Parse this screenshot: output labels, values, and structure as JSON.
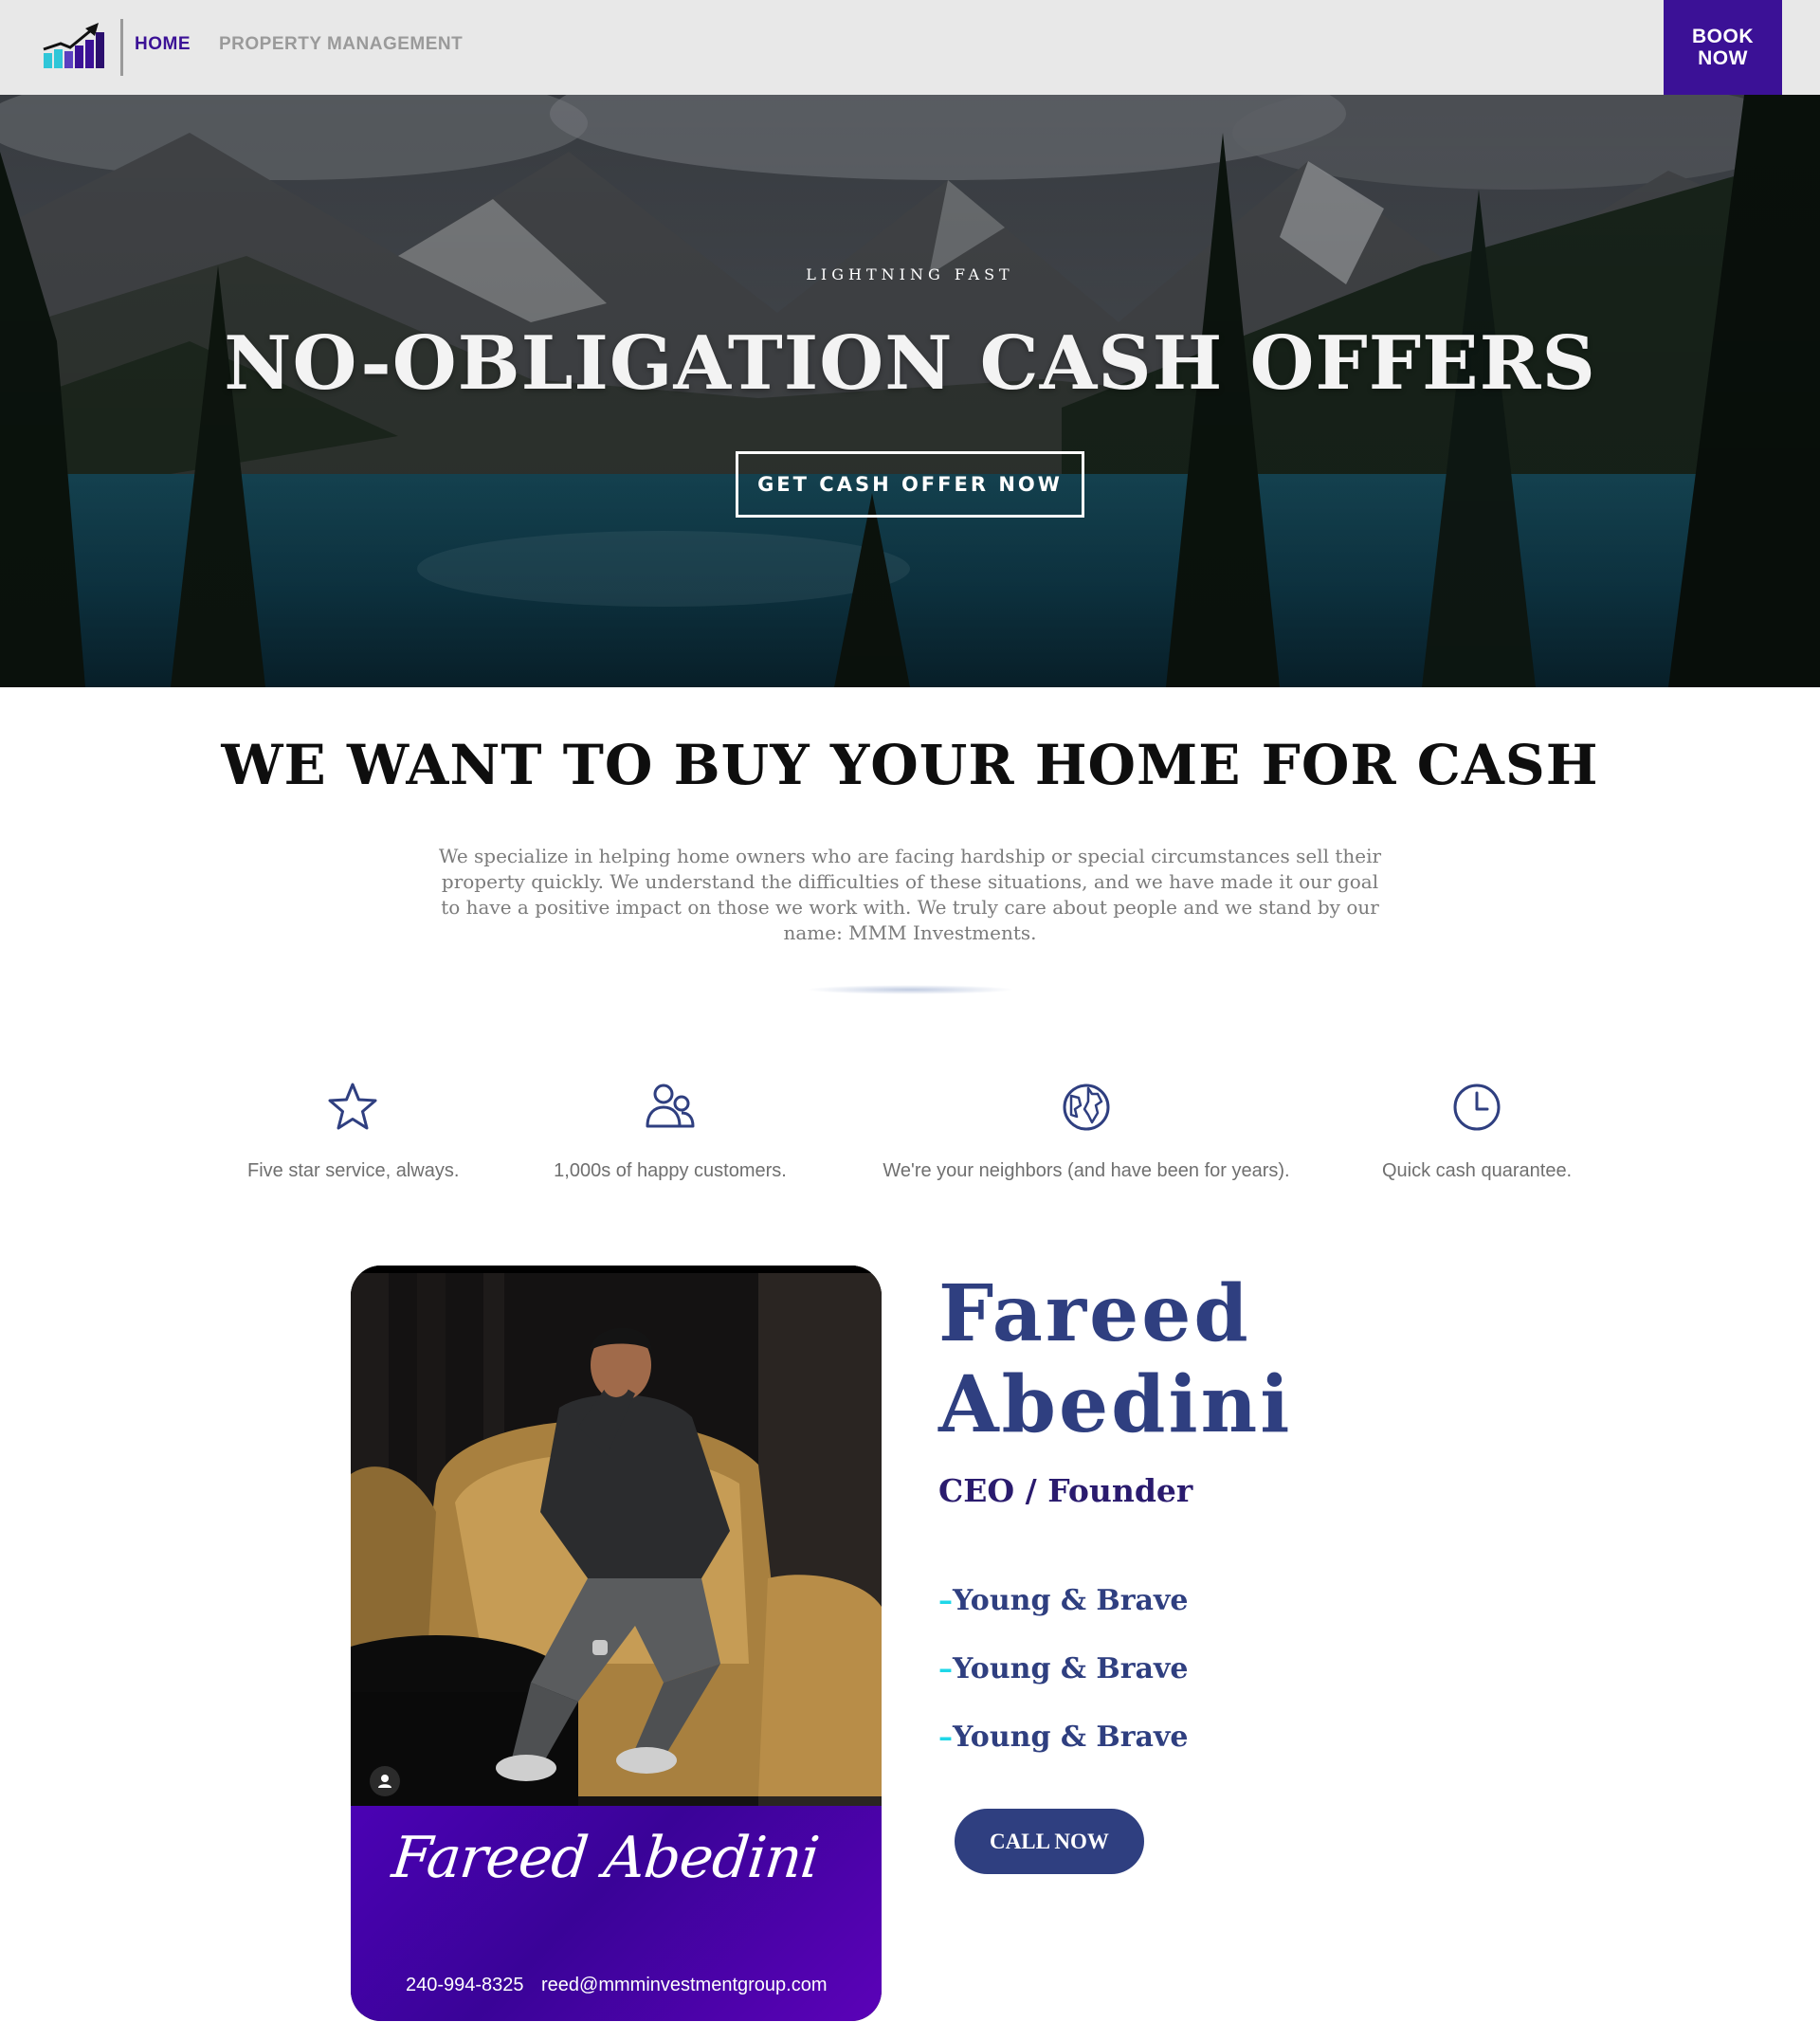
{
  "nav": {
    "home_label": "HOME",
    "property_label": "PROPERTY MANAGEMENT",
    "book_line1": "BOOK",
    "book_line2": "NOW",
    "logo_icon": "chart-arrow-logo-icon",
    "accent": "#3b1196"
  },
  "hero": {
    "kicker": "LIGHTNING FAST",
    "title": "NO-OBLIGATION CASH OFFERS",
    "cta": "GET CASH OFFER NOW"
  },
  "intro": {
    "title": "WE WANT TO BUY YOUR HOME FOR CASH",
    "text": "We specialize in helping home owners who are facing hardship or special circumstances sell their property quickly. We understand the difficulties of these situations, and we have made it our goal to have a positive impact on those we work with. We truly care about people and we stand by our name: MMM Investments."
  },
  "features": [
    {
      "icon": "star-icon",
      "text": "Five star service, always."
    },
    {
      "icon": "users-icon",
      "text": "1,000s of happy customers."
    },
    {
      "icon": "globe-icon",
      "text": "We're your neighbors (and have been for years)."
    },
    {
      "icon": "clock-icon",
      "text": "Quick cash quarantee."
    }
  ],
  "profile": {
    "first_name": "Fareed",
    "last_name": "Abedini",
    "role": "CEO / Founder",
    "traits": [
      "Young & Brave",
      "Young & Brave",
      "Young & Brave"
    ],
    "dash": "–",
    "call_label": "CALL NOW",
    "card_signature": "Fareed Abedini",
    "card_phone": "240-994-8325",
    "card_email": "reed@mmminvestmentgroup.com"
  },
  "colors": {
    "brand_purple": "#3b1196",
    "navy": "#2f3f80",
    "cyan": "#1fd7e8"
  }
}
